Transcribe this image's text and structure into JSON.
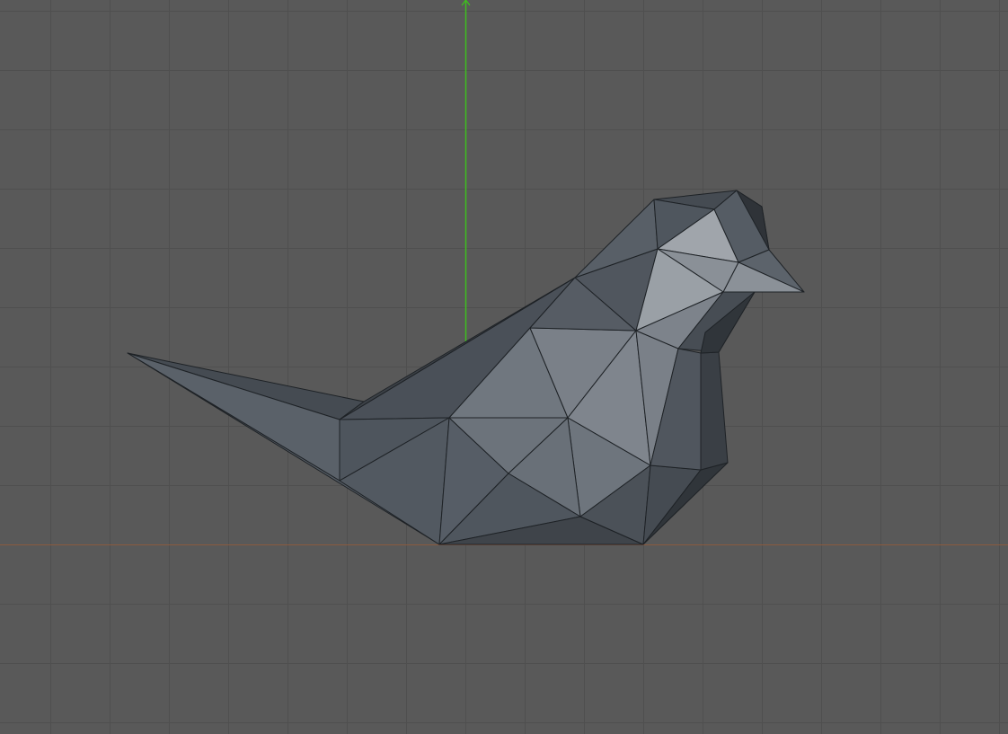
{
  "viewport": {
    "background_color": "#595959",
    "grid_color": "#4f4f4f",
    "y_axis_color": "#3ec01e",
    "x_axis_color": "#8a5a3e",
    "object": "low-poly-bird"
  }
}
